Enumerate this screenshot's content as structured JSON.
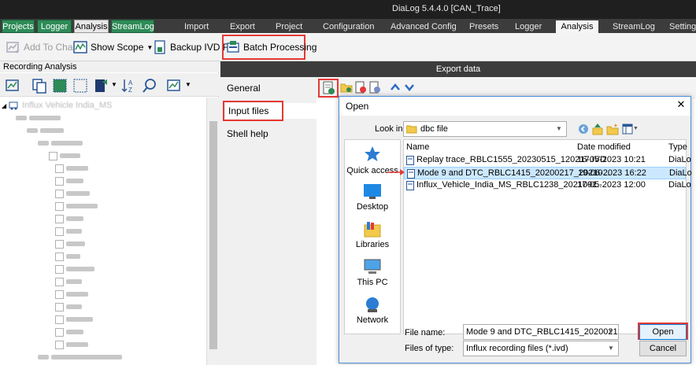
{
  "titlebar": {
    "title": "DiaLog 5.4.4.0   [CAN_Trace]"
  },
  "left_tabs": [
    {
      "label": "Projects"
    },
    {
      "label": "Logger"
    },
    {
      "label": "Analysis"
    },
    {
      "label": "StreamLog"
    }
  ],
  "main_tabs": [
    {
      "label": "Import"
    },
    {
      "label": "Export"
    },
    {
      "label": "Project"
    },
    {
      "label": "Configuration"
    },
    {
      "label": "Advanced Config"
    },
    {
      "label": "Presets"
    },
    {
      "label": "Logger"
    },
    {
      "label": "Analysis"
    },
    {
      "label": "StreamLog"
    },
    {
      "label": "Settings"
    }
  ],
  "ribbon": {
    "add_to_chart": "Add To Chart",
    "show_scope": "Show Scope",
    "backup_ivd": "Backup IVD File",
    "batch_processing": "Batch Processing"
  },
  "left_panel": {
    "header": "Recording Analysis",
    "tree_root": "Influx Vehicle India_MS"
  },
  "export": {
    "title": "Export data",
    "nav": [
      {
        "label": "General"
      },
      {
        "label": "Input files"
      },
      {
        "label": "Shell help"
      }
    ]
  },
  "open_dialog": {
    "title": "Open",
    "close": "✕",
    "look_in_label": "Look in:",
    "look_in_value": "dbc file",
    "places": [
      {
        "label": "Quick access"
      },
      {
        "label": "Desktop"
      },
      {
        "label": "Libraries"
      },
      {
        "label": "This PC"
      },
      {
        "label": "Network"
      }
    ],
    "columns": {
      "name": "Name",
      "date": "Date modified",
      "type": "Type"
    },
    "files": [
      {
        "name": "Replay trace_RBLC1555_20230515_120217.IVD",
        "date": "16-05-2023 10:21",
        "type": "DiaLo"
      },
      {
        "name": "Mode 9 and DTC_RBLC1415_20200217_20210...",
        "date": "19-06-2023 16:22",
        "type": "DiaLo"
      },
      {
        "name": "Influx_Vehicle_India_MS_RBLC1238_2021091...",
        "date": "17-05-2023 12:00",
        "type": "DiaLo"
      }
    ],
    "file_name_label": "File name:",
    "file_name_value": "Mode 9 and DTC_RBLC1415_20200217_2021",
    "file_type_label": "Files of type:",
    "file_type_value": "Influx recording files (*.ivd)",
    "open_button": "Open",
    "cancel_button": "Cancel"
  },
  "colors": {
    "accent_green": "#2e8b57",
    "highlight_red": "#e53935",
    "selection": "#cce8ff"
  }
}
